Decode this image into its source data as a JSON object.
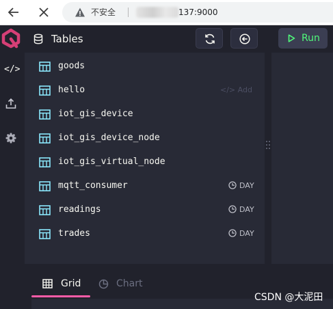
{
  "browser": {
    "security_label": "不安全",
    "url": "137:9000",
    "back_icon": "back-arrow-icon",
    "close_icon": "close-icon"
  },
  "rail": {
    "items": [
      {
        "icon": "code-icon",
        "label": "</>"
      },
      {
        "icon": "upload-icon"
      },
      {
        "icon": "gear-icon"
      }
    ]
  },
  "panel": {
    "title": "Tables",
    "tables": [
      {
        "name": "goods",
        "partition": ""
      },
      {
        "name": "hello",
        "partition": "",
        "hover_action": "Add"
      },
      {
        "name": "iot_gis_device",
        "partition": ""
      },
      {
        "name": "iot_gis_device_node",
        "partition": ""
      },
      {
        "name": "iot_gis_virtual_node",
        "partition": ""
      },
      {
        "name": "mqtt_consumer",
        "partition": "DAY"
      },
      {
        "name": "readings",
        "partition": "DAY"
      },
      {
        "name": "trades",
        "partition": "DAY"
      }
    ]
  },
  "editor": {
    "run_label": "Run"
  },
  "results": {
    "tabs": [
      {
        "label": "Grid",
        "active": true
      },
      {
        "label": "Chart",
        "active": false
      }
    ]
  },
  "watermark": "CSDN @大泥田",
  "colors": {
    "accent_green": "#50fa7b",
    "accent_pink": "#ff5ca8",
    "table_icon": "#8be9fd",
    "background": "#21222c",
    "panel": "#282a36"
  }
}
